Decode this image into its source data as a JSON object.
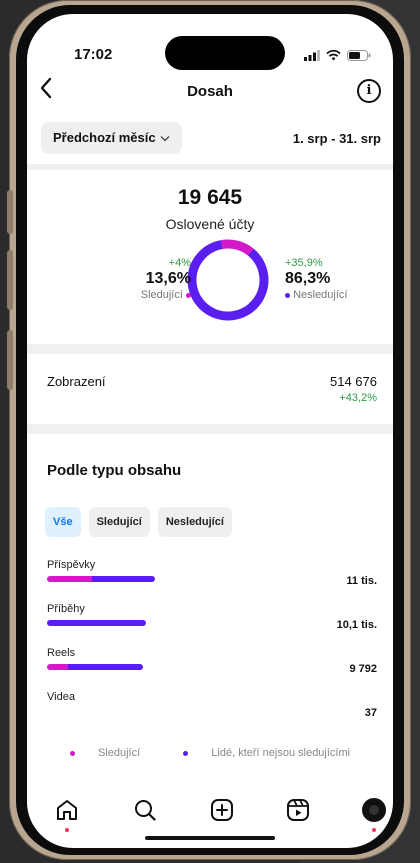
{
  "status_bar": {
    "time": "17:02"
  },
  "nav": {
    "title": "Dosah"
  },
  "period": {
    "selector_label": "Předchozí měsíc",
    "date_range": "1. srp - 31. srp"
  },
  "reach": {
    "total": "19 645",
    "label": "Oslovené účty",
    "followers": {
      "delta": "+4%",
      "pct": "13,6%",
      "label": "Sledující",
      "fraction": 0.136
    },
    "non_followers": {
      "delta": "+35,9%",
      "pct": "86,3%",
      "label": "Nesledující",
      "fraction": 0.863
    }
  },
  "impressions": {
    "label": "Zobrazení",
    "value": "514 676",
    "delta": "+43,2%"
  },
  "content_types": {
    "title": "Podle typu obsahu",
    "filters": [
      "Vše",
      "Sledující",
      "Nesledující"
    ],
    "items": [
      {
        "name": "Příspěvky",
        "value": "11 tis.",
        "followers_share": 0.42,
        "total_share": 1.0
      },
      {
        "name": "Příběhy",
        "value": "10,1 tis.",
        "followers_share": 0.0,
        "total_share": 0.92
      },
      {
        "name": "Reels",
        "value": "9 792",
        "followers_share": 0.22,
        "total_share": 0.89
      },
      {
        "name": "Videa",
        "value": "37",
        "followers_share": 0.0,
        "total_share": 0.0
      }
    ]
  },
  "legend": {
    "followers": "Sledující",
    "non_followers": "Lidé, kteří nejsou sledujícími"
  },
  "colors": {
    "followers": "#d31ac8",
    "non_followers": "#5a1ff0",
    "positive": "#2e9a46",
    "active_chip": "#0a7ae6"
  },
  "tabbar": {
    "icons": [
      "home-icon",
      "search-icon",
      "create-icon",
      "reels-icon",
      "profile-avatar"
    ]
  }
}
